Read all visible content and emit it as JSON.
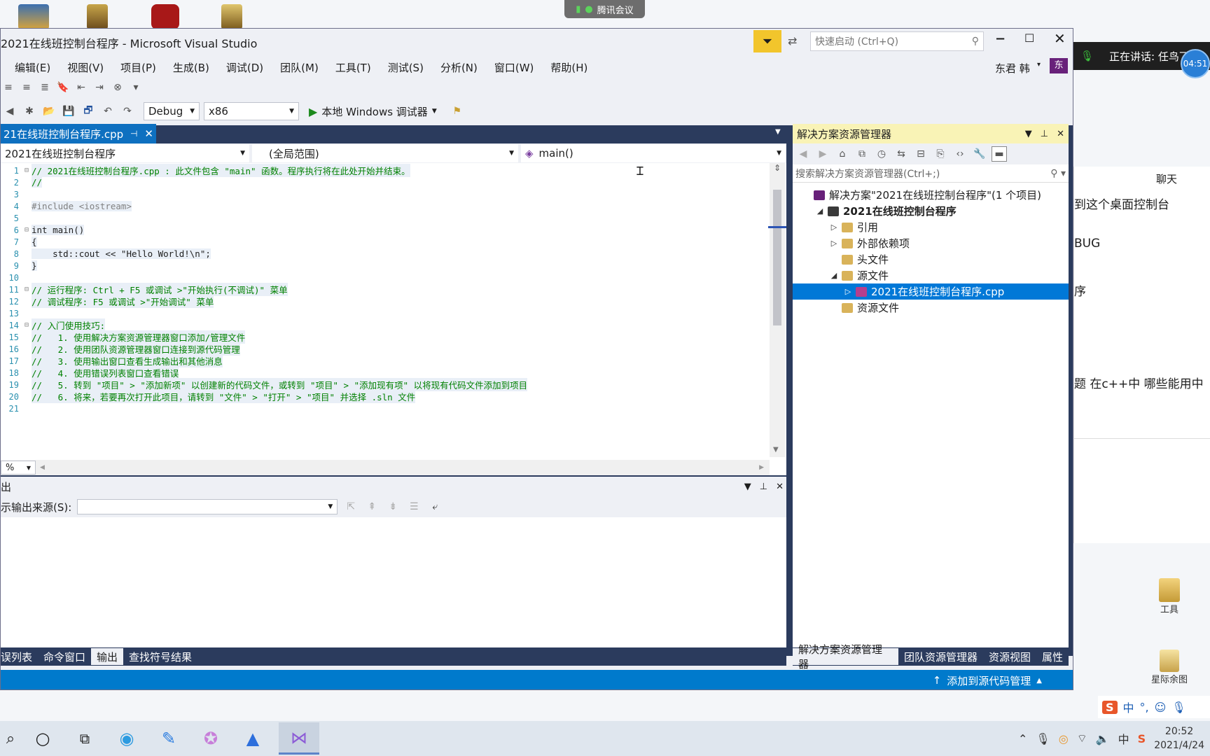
{
  "meeting": {
    "label": "腾讯会议"
  },
  "window": {
    "title": "2021在线班控制台程序 - Microsoft Visual Studio",
    "quick_launch_placeholder": "快速启动 (Ctrl+Q)",
    "user": "东君 韩",
    "user_badge": "东",
    "speaking": "正在讲话: 任鸟飞;",
    "time_badge": "04:51"
  },
  "menu": [
    "编辑(E)",
    "视图(V)",
    "项目(P)",
    "生成(B)",
    "调试(D)",
    "团队(M)",
    "工具(T)",
    "测试(S)",
    "分析(N)",
    "窗口(W)",
    "帮助(H)"
  ],
  "toolbar": {
    "config": "Debug",
    "platform": "x86",
    "run_label": "本地 Windows 调试器"
  },
  "editor": {
    "tab": "21在线班控制台程序.cpp",
    "project_combo": "2021在线班控制台程序",
    "scope_combo": "(全局范围)",
    "member_combo": "main()",
    "zoom": "%",
    "lines": [
      {
        "n": "1",
        "fold": "⊟",
        "text": "// 2021在线班控制台程序.cpp : 此文件包含 \"main\" 函数。程序执行将在此处开始并结束。",
        "cls": "cmt"
      },
      {
        "n": "2",
        "fold": "",
        "text": "//",
        "cls": "cmt"
      },
      {
        "n": "3",
        "fold": "",
        "text": "",
        "cls": ""
      },
      {
        "n": "4",
        "fold": "",
        "text": "#include <iostream>",
        "cls": "pp"
      },
      {
        "n": "5",
        "fold": "",
        "text": "",
        "cls": ""
      },
      {
        "n": "6",
        "fold": "⊟",
        "text": "int main()",
        "cls": ""
      },
      {
        "n": "7",
        "fold": "",
        "text": "{",
        "cls": ""
      },
      {
        "n": "8",
        "fold": "",
        "text": "    std::cout << \"Hello World!\\n\";",
        "cls": ""
      },
      {
        "n": "9",
        "fold": "",
        "text": "}",
        "cls": ""
      },
      {
        "n": "10",
        "fold": "",
        "text": "",
        "cls": ""
      },
      {
        "n": "11",
        "fold": "⊟",
        "text": "// 运行程序: Ctrl + F5 或调试 >\"开始执行(不调试)\" 菜单",
        "cls": "cmt"
      },
      {
        "n": "12",
        "fold": "",
        "text": "// 调试程序: F5 或调试 >\"开始调试\" 菜单",
        "cls": "cmt"
      },
      {
        "n": "13",
        "fold": "",
        "text": "",
        "cls": ""
      },
      {
        "n": "14",
        "fold": "⊟",
        "text": "// 入门使用技巧:",
        "cls": "cmt"
      },
      {
        "n": "15",
        "fold": "",
        "text": "//   1. 使用解决方案资源管理器窗口添加/管理文件",
        "cls": "cmt"
      },
      {
        "n": "16",
        "fold": "",
        "text": "//   2. 使用团队资源管理器窗口连接到源代码管理",
        "cls": "cmt"
      },
      {
        "n": "17",
        "fold": "",
        "text": "//   3. 使用输出窗口查看生成输出和其他消息",
        "cls": "cmt"
      },
      {
        "n": "18",
        "fold": "",
        "text": "//   4. 使用错误列表窗口查看错误",
        "cls": "cmt"
      },
      {
        "n": "19",
        "fold": "",
        "text": "//   5. 转到 \"项目\" > \"添加新项\" 以创建新的代码文件，或转到 \"项目\" > \"添加现有项\" 以将现有代码文件添加到项目",
        "cls": "cmt"
      },
      {
        "n": "20",
        "fold": "",
        "text": "//   6. 将来，若要再次打开此项目，请转到 \"文件\" > \"打开\" > \"项目\" 并选择 .sln 文件",
        "cls": "cmt"
      },
      {
        "n": "21",
        "fold": "",
        "text": "",
        "cls": ""
      }
    ]
  },
  "output": {
    "title": "出",
    "source_label": "示输出来源(S):"
  },
  "bottom_tabs": [
    "误列表",
    "命令窗口",
    "输出",
    "查找符号结果"
  ],
  "solution": {
    "title": "解决方案资源管理器",
    "search_placeholder": "搜索解决方案资源管理器(Ctrl+;)",
    "items": [
      {
        "label": "解决方案\"2021在线班控制台程序\"(1 个项目)",
        "indent": 0,
        "tri": "",
        "bold": false,
        "selected": false
      },
      {
        "label": "2021在线班控制台程序",
        "indent": 1,
        "tri": "◢",
        "bold": true,
        "selected": false
      },
      {
        "label": "引用",
        "indent": 2,
        "tri": "▷",
        "bold": false,
        "selected": false
      },
      {
        "label": "外部依赖项",
        "indent": 2,
        "tri": "▷",
        "bold": false,
        "selected": false
      },
      {
        "label": "头文件",
        "indent": 2,
        "tri": "",
        "bold": false,
        "selected": false
      },
      {
        "label": "源文件",
        "indent": 2,
        "tri": "◢",
        "bold": false,
        "selected": false
      },
      {
        "label": "2021在线班控制台程序.cpp",
        "indent": 3,
        "tri": "▷",
        "bold": false,
        "selected": true
      },
      {
        "label": "资源文件",
        "indent": 2,
        "tri": "",
        "bold": false,
        "selected": false
      }
    ],
    "tabs": [
      "解决方案资源管理器",
      "团队资源管理器",
      "资源视图",
      "属性"
    ]
  },
  "statusbar": {
    "source_control": "添加到源代码管理"
  },
  "chat": {
    "title": "聊天",
    "lines": [
      "到这个桌面控制台",
      "BUG",
      "序",
      "题   在c++中  哪些能用中"
    ]
  },
  "desktop": {
    "icon_tools": "工具",
    "icon_star": "星际余图"
  },
  "taskbar": {
    "time": "20:52",
    "date": "2021/4/24",
    "ime": "中"
  },
  "colors": {
    "accent": "#0e70c0",
    "selected": "#0078d7",
    "dark_band": "#2b3b5d",
    "status_bar": "#007acc"
  }
}
